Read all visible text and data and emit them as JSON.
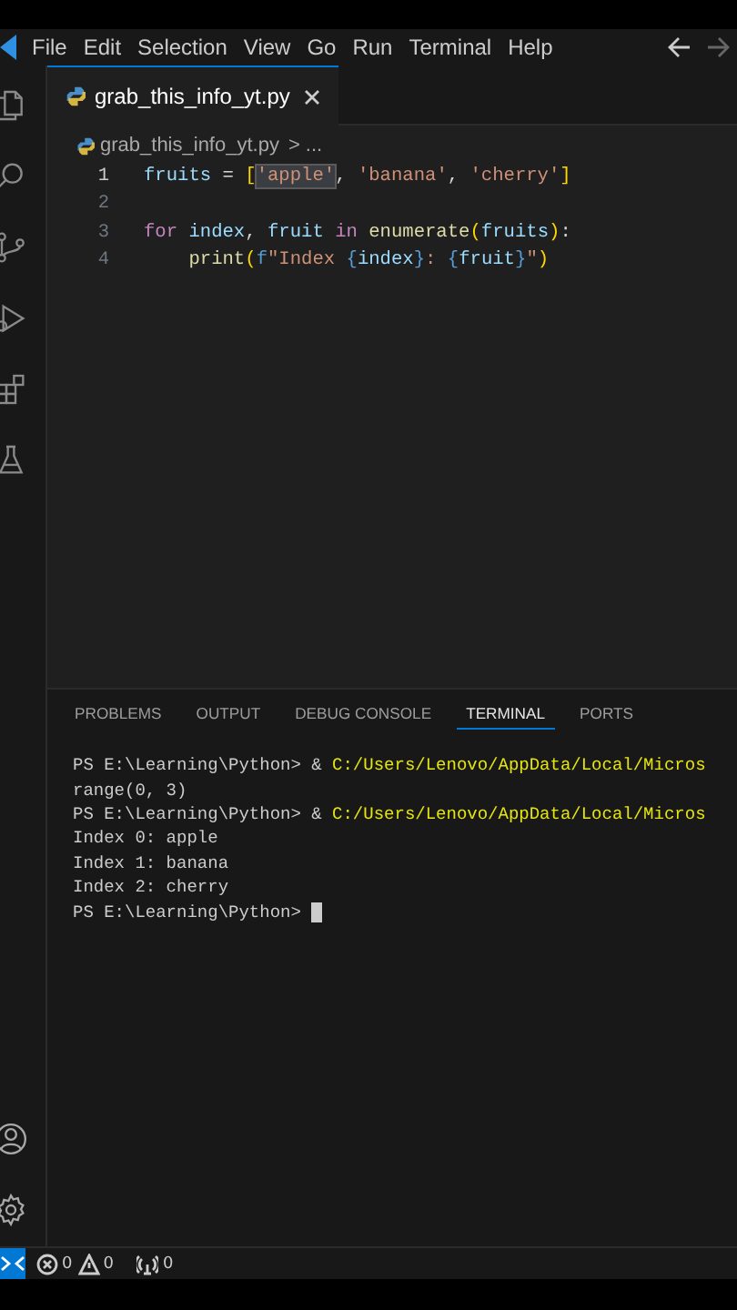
{
  "menu_bar": {
    "items": [
      "File",
      "Edit",
      "Selection",
      "View",
      "Go",
      "Run",
      "Terminal",
      "Help"
    ]
  },
  "activity_bar": {
    "items": [
      {
        "kind": "explorer"
      },
      {
        "kind": "search"
      },
      {
        "kind": "source-control"
      },
      {
        "kind": "run-debug"
      },
      {
        "kind": "extensions"
      },
      {
        "kind": "testing"
      }
    ],
    "bottom": [
      {
        "kind": "account"
      },
      {
        "kind": "settings"
      }
    ]
  },
  "tabs": [
    {
      "label": "grab_this_info_yt.py",
      "selected": true
    }
  ],
  "breadcrumb": {
    "file": "grab_this_info_yt.py",
    "separator": ">",
    "more": "..."
  },
  "code": {
    "lines": [
      {
        "number": "1",
        "current": true,
        "tokens": [
          {
            "text": "fruits",
            "kind": "variable",
            "highlighted": false
          },
          {
            "text": " = ",
            "kind": "plain",
            "highlighted": false
          },
          {
            "text": "[",
            "kind": "bracket",
            "highlighted": false
          },
          {
            "text": "'apple'",
            "kind": "string",
            "highlighted": true
          },
          {
            "text": ", ",
            "kind": "plain",
            "highlighted": false
          },
          {
            "text": "'banana'",
            "kind": "string",
            "highlighted": false
          },
          {
            "text": ", ",
            "kind": "plain",
            "highlighted": false
          },
          {
            "text": "'cherry'",
            "kind": "string",
            "highlighted": false
          },
          {
            "text": "]",
            "kind": "bracket",
            "highlighted": false
          }
        ]
      },
      {
        "number": "2",
        "current": false
      },
      {
        "number": "3",
        "current": false,
        "tokens": [
          {
            "text": "for ",
            "kind": "keyword",
            "highlighted": false
          },
          {
            "text": "index",
            "kind": "variable",
            "highlighted": false
          },
          {
            "text": ", ",
            "kind": "plain",
            "highlighted": false
          },
          {
            "text": "fruit ",
            "kind": "variable",
            "highlighted": false
          },
          {
            "text": "in ",
            "kind": "keyword",
            "highlighted": false
          },
          {
            "text": "enumerate",
            "kind": "function",
            "highlighted": false
          },
          {
            "text": "(",
            "kind": "bracket",
            "highlighted": false
          },
          {
            "text": "fruits",
            "kind": "variable",
            "highlighted": false
          },
          {
            "text": ")",
            "kind": "bracket",
            "highlighted": false
          },
          {
            "text": ":",
            "kind": "plain",
            "highlighted": false
          }
        ]
      },
      {
        "number": "4",
        "current": false,
        "tokens": [
          {
            "text": "    print",
            "kind": "function",
            "highlighted": false
          },
          {
            "text": "(",
            "kind": "bracket",
            "highlighted": false
          },
          {
            "text": "f",
            "kind": "storage",
            "highlighted": false
          },
          {
            "text": "\"Index ",
            "kind": "string",
            "highlighted": false
          },
          {
            "text": "{",
            "kind": "storage",
            "highlighted": false
          },
          {
            "text": "index",
            "kind": "variable",
            "highlighted": false
          },
          {
            "text": "}",
            "kind": "storage",
            "highlighted": false
          },
          {
            "text": ": ",
            "kind": "string",
            "highlighted": false
          },
          {
            "text": "{",
            "kind": "storage",
            "highlighted": false
          },
          {
            "text": "fruit",
            "kind": "variable",
            "highlighted": false
          },
          {
            "text": "}",
            "kind": "storage",
            "highlighted": false
          },
          {
            "text": "\"",
            "kind": "string",
            "highlighted": false
          },
          {
            "text": ")",
            "kind": "bracket",
            "highlighted": false
          }
        ]
      }
    ]
  },
  "panel": {
    "tabs": [
      {
        "label": "PROBLEMS",
        "selected": false
      },
      {
        "label": "OUTPUT",
        "selected": false
      },
      {
        "label": "DEBUG CONSOLE",
        "selected": false
      },
      {
        "label": "TERMINAL",
        "selected": true
      },
      {
        "label": "PORTS",
        "selected": false
      }
    ],
    "terminal": {
      "lines": [
        {
          "cursor": false,
          "segments": [
            {
              "text": "PS E:\\Learning\\Python> & ",
              "kind": "plain"
            },
            {
              "text": "C:/Users/Lenovo/AppData/Local/Micros",
              "kind": "path"
            }
          ]
        },
        {
          "cursor": false,
          "segments": [
            {
              "text": "range(0, 3)",
              "kind": "plain"
            }
          ]
        },
        {
          "cursor": false,
          "segments": [
            {
              "text": "PS E:\\Learning\\Python> & ",
              "kind": "plain"
            },
            {
              "text": "C:/Users/Lenovo/AppData/Local/Micros",
              "kind": "path"
            }
          ]
        },
        {
          "cursor": false,
          "segments": [
            {
              "text": "Index 0: apple",
              "kind": "plain"
            }
          ]
        },
        {
          "cursor": false,
          "segments": [
            {
              "text": "Index 1: banana",
              "kind": "plain"
            }
          ]
        },
        {
          "cursor": false,
          "segments": [
            {
              "text": "Index 2: cherry",
              "kind": "plain"
            }
          ]
        },
        {
          "cursor": true,
          "segments": [
            {
              "text": "PS E:\\Learning\\Python> ",
              "kind": "plain"
            }
          ]
        }
      ]
    }
  },
  "status_bar": {
    "items": [
      {
        "kind": "errors",
        "text": "0"
      },
      {
        "kind": "warnings",
        "text": "0"
      },
      {
        "kind": "ports",
        "text": "0"
      }
    ]
  }
}
